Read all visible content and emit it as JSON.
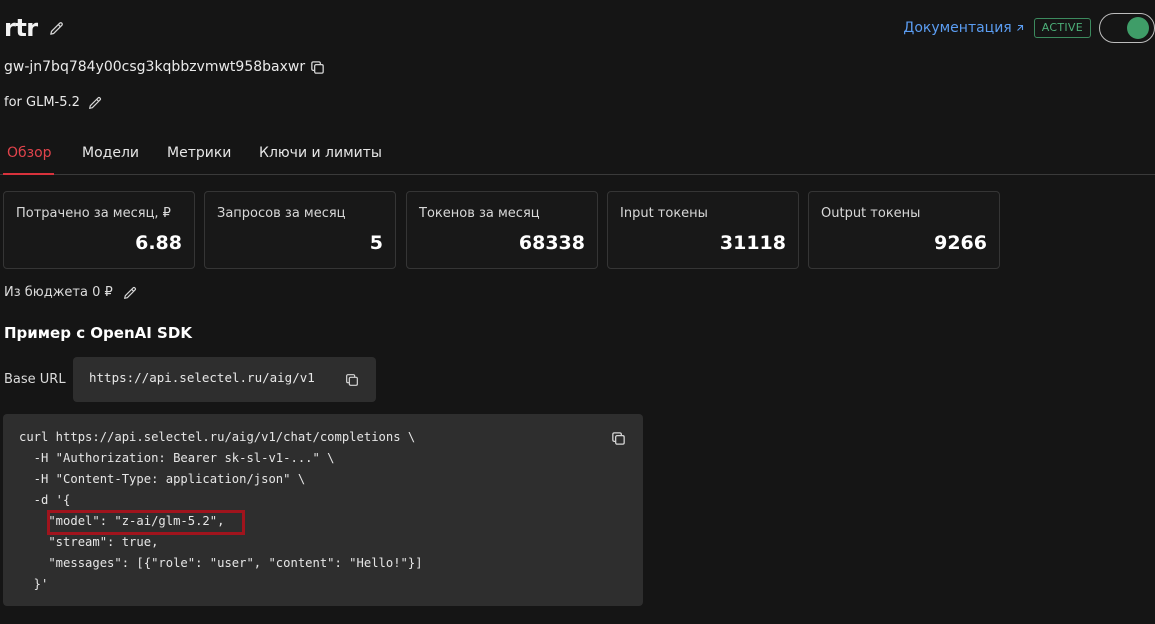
{
  "header": {
    "title": "rtr",
    "gateway_id": "gw-jn7bq784y00csg3kqbbzvmwt958baxwr",
    "description": "for GLM-5.2",
    "doc_link": "Документация",
    "status": "ACTIVE",
    "active": true
  },
  "tabs": [
    {
      "label": "Обзор",
      "active": true
    },
    {
      "label": "Модели",
      "active": false
    },
    {
      "label": "Метрики",
      "active": false
    },
    {
      "label": "Ключи и лимиты",
      "active": false
    }
  ],
  "stats": [
    {
      "label": "Потрачено за месяц, ₽",
      "value": "6.88"
    },
    {
      "label": "Запросов за месяц",
      "value": "5"
    },
    {
      "label": "Токенов за месяц",
      "value": "68338"
    },
    {
      "label": "Input токены",
      "value": "31118"
    },
    {
      "label": "Output токены",
      "value": "9266"
    }
  ],
  "budget": "Из бюджета 0 ₽",
  "sdk": {
    "title": "Пример с OpenAI SDK",
    "base_url_label": "Base URL",
    "base_url": "https://api.selectel.ru/aig/v1",
    "code_lines": [
      "curl https://api.selectel.ru/aig/v1/chat/completions \\",
      "  -H \"Authorization: Bearer sk-sl-v1-...\" \\",
      "  -H \"Content-Type: application/json\" \\",
      "  -d '{",
      "    \"model\": \"z-ai/glm-5.2\",",
      "    \"stream\": true,",
      "    \"messages\": [{\"role\": \"user\", \"content\": \"Hello!\"}]",
      "  }'"
    ]
  },
  "icons": {
    "edit": "pencil-icon",
    "copy": "copy-icon",
    "external": "arrow-up-right-icon"
  },
  "colors": {
    "accent": "#d8323c",
    "link": "#5b9df2",
    "status": "#4caf78",
    "highlight": "#a0141d"
  }
}
